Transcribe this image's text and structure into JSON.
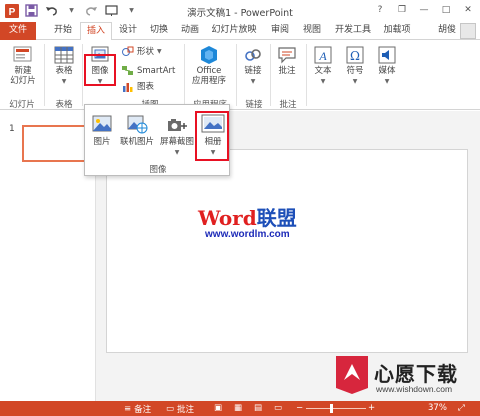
{
  "window": {
    "title": "演示文稿1 - PowerPoint",
    "controls": {
      "help": "?",
      "restore": "❐",
      "minimize": "—",
      "maximize": "□",
      "close": "✕"
    }
  },
  "qat": {
    "icons": [
      "powerpoint-icon",
      "save-icon",
      "undo-icon",
      "redo-icon",
      "start-slideshow-icon",
      "customize-qat-icon"
    ]
  },
  "tabs": {
    "file": "文件",
    "home": "开始",
    "insert": "插入",
    "design": "设计",
    "transitions": "切换",
    "animations": "动画",
    "slideshow": "幻灯片放映",
    "review": "审阅",
    "view": "视图",
    "developer": "开发工具",
    "addins": "加载项"
  },
  "user": {
    "name": "胡俊"
  },
  "ribbon": {
    "new_slide": {
      "line1": "新建",
      "line2": "幻灯片"
    },
    "table": "表格",
    "images": "图像",
    "shapes": "形状",
    "smartart": "SmartArt",
    "chart": "图表",
    "office_apps": {
      "line1": "Office",
      "line2": "应用程序"
    },
    "links": "链接",
    "comment": "批注",
    "text": "文本",
    "symbols": "符号",
    "media": "媒体",
    "groups": {
      "slides": "幻灯片",
      "tables": "表格",
      "illustrations": "插图",
      "apps": "应用程序",
      "links": "链接",
      "comments": "批注"
    }
  },
  "dropdown": {
    "pictures": "图片",
    "online_pictures": "联机图片",
    "screenshot": "屏幕截图",
    "photo_album": "相册",
    "group_label": "图像"
  },
  "thumbnails": {
    "number": "1"
  },
  "watermark": {
    "word_red": "Word",
    "word_blue": "联盟",
    "url": "www.wordlm.com"
  },
  "logo_watermark": {
    "text": "心愿下载",
    "url": "www.wishdown.com"
  },
  "statusbar": {
    "notes": "备注",
    "comments": "批注",
    "zoom": "37%"
  },
  "colors": {
    "accent": "#d24726",
    "highlight": "#e81123",
    "watermark_red": "#e02020",
    "watermark_blue": "#1d4fb8"
  }
}
